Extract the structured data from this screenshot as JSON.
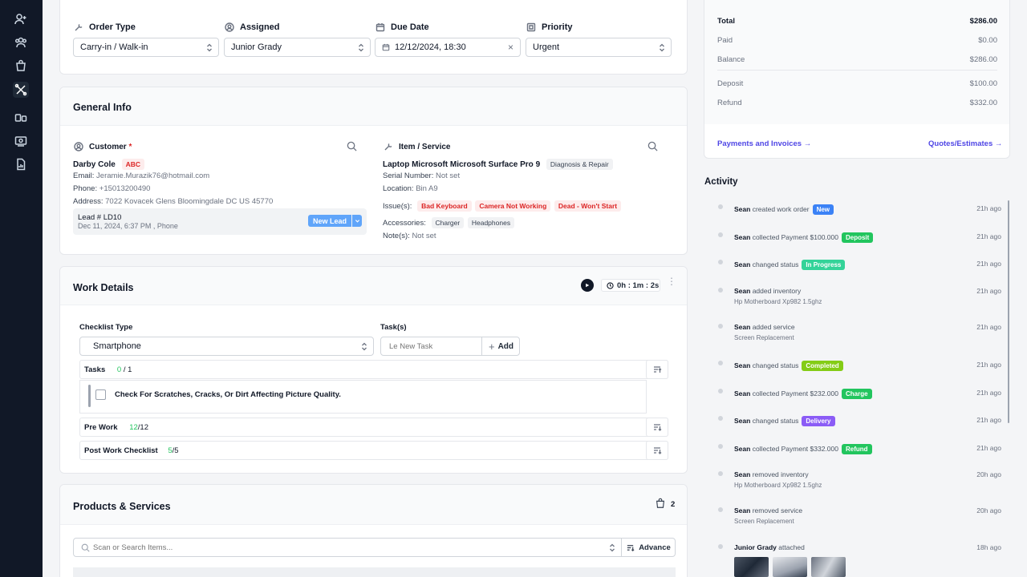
{
  "sidebar": {
    "items": [
      {
        "name": "add-user"
      },
      {
        "name": "customers"
      },
      {
        "name": "shop"
      },
      {
        "name": "repairs"
      },
      {
        "name": "devices"
      },
      {
        "name": "payments"
      },
      {
        "name": "reports"
      }
    ]
  },
  "order": {
    "order_type_label": "Order Type",
    "order_type_value": "Carry-in / Walk-in",
    "assigned_label": "Assigned",
    "assigned_value": "Junior Grady",
    "due_date_label": "Due Date",
    "due_date_value": "12/12/2024, 18:30",
    "priority_label": "Priority",
    "priority_value": "Urgent"
  },
  "general_info": {
    "title": "General Info",
    "customer_label": "Customer",
    "required_mark": "*",
    "customer_name": "Darby Cole",
    "customer_tag": "ABC",
    "email_label": "Email:",
    "email": "Jeramie.Murazik76@hotmail.com",
    "phone_label": "Phone:",
    "phone": "+15013200490",
    "address_label": "Address:",
    "address": "7022 Kovacek Glens Bloomingdale DC US 45770",
    "lead_title": "Lead # LD10",
    "lead_sub": "Dec 11, 2024, 6:37 PM , Phone",
    "new_lead_button": "New Lead",
    "item_label": "Item / Service",
    "item_name": "Laptop Microsoft Microsoft Surface Pro 9",
    "item_tag": "Diagnosis & Repair",
    "serial_label": "Serial Number:",
    "serial_value": "Not set",
    "location_label": "Location:",
    "location_value": "Bin A9",
    "issues_label": "Issue(s):",
    "issues": [
      "Bad Keyboard",
      "Camera Not Working",
      "Dead - Won't Start"
    ],
    "accessories_label": "Accessories:",
    "accessories": [
      "Charger",
      "Headphones"
    ],
    "notes_label": "Note(s):",
    "notes_value": "Not set"
  },
  "work_details": {
    "title": "Work Details",
    "timer": "0h : 1m : 2s",
    "checklist_type_label": "Checklist Type",
    "checklist_type_value": "Smartphone",
    "tasks_label": "Task(s)",
    "new_task_placeholder": "Le New Task",
    "add_button": "Add",
    "tasks_row_label": "Tasks",
    "tasks_done": "0",
    "tasks_total": "/ 1",
    "task_item": "Check For Scratches, Cracks, Or Dirt Affecting Picture Quality.",
    "pre_work_label": "Pre Work",
    "pre_work_done": "12",
    "pre_work_total": "/12",
    "post_work_label": "Post Work Checklist",
    "post_work_done": "5",
    "post_work_total": "/5"
  },
  "products": {
    "title": "Products & Services",
    "count": "2",
    "search_placeholder": "Scan or Search Items...",
    "advance_button": "Advance"
  },
  "summary": {
    "total_label": "Total",
    "total_value": "$286.00",
    "paid_label": "Paid",
    "paid_value": "$0.00",
    "balance_label": "Balance",
    "balance_value": "$286.00",
    "deposit_label": "Deposit",
    "deposit_value": "$100.00",
    "refund_label": "Refund",
    "refund_value": "$332.00",
    "payments_link": "Payments and Invoices →",
    "quotes_link": "Quotes/Estimates →"
  },
  "activity": {
    "title": "Activity",
    "items": [
      {
        "who": "Sean",
        "text": "created work order",
        "status": "New",
        "color": "#3b82f6",
        "time": "21h ago"
      },
      {
        "who": "Sean",
        "text": "collected Payment $100.000",
        "status": "Deposit",
        "color": "#22c55e",
        "time": "21h ago"
      },
      {
        "who": "Sean",
        "text": "changed status",
        "status": "In Progress",
        "color": "#34d399",
        "time": "21h ago"
      },
      {
        "who": "Sean",
        "text": "added inventory",
        "sub": "Hp Motherboard Xp982 1.5ghz",
        "time": "21h ago"
      },
      {
        "who": "Sean",
        "text": "added service",
        "sub": "Screen Replacement",
        "time": "21h ago"
      },
      {
        "who": "Sean",
        "text": "changed status",
        "status": "Completed",
        "color": "#84cc16",
        "time": "21h ago"
      },
      {
        "who": "Sean",
        "text": "collected Payment $232.000",
        "status": "Charge",
        "color": "#22c55e",
        "time": "21h ago"
      },
      {
        "who": "Sean",
        "text": "changed status",
        "status": "Delivery",
        "color": "#8b5cf6",
        "time": "21h ago"
      },
      {
        "who": "Sean",
        "text": "collected Payment $332.000",
        "status": "Refund",
        "color": "#22c55e",
        "time": "21h ago"
      },
      {
        "who": "Sean",
        "text": "removed inventory",
        "sub": "Hp Motherboard Xp982 1.5ghz",
        "time": "20h ago"
      },
      {
        "who": "Sean",
        "text": "removed service",
        "sub": "Screen Replacement",
        "time": "20h ago"
      },
      {
        "who": "Junior Grady",
        "text": "attached",
        "time": "18h ago"
      }
    ]
  }
}
